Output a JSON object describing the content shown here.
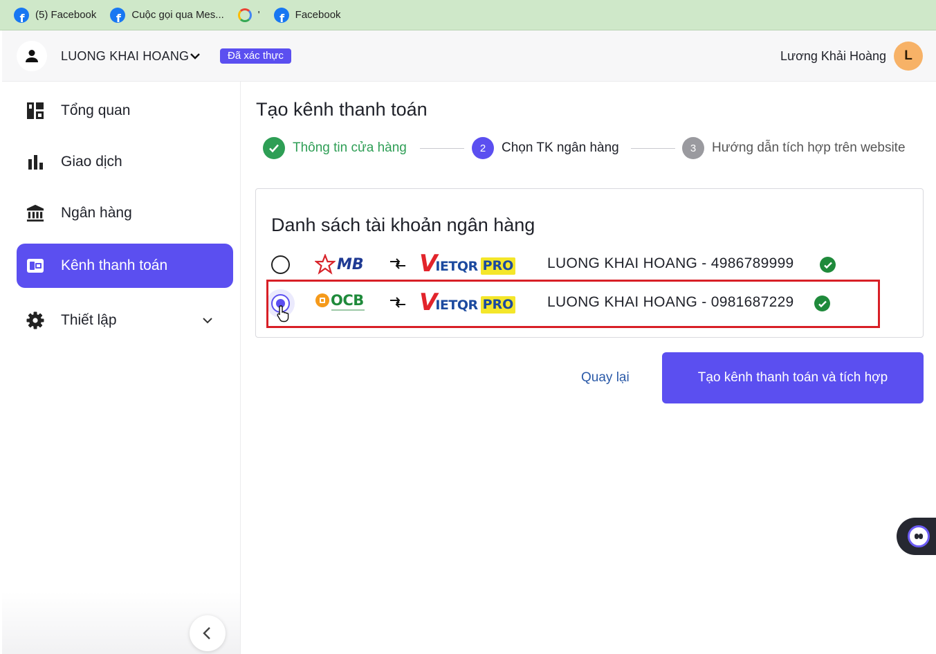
{
  "bookmarks": [
    {
      "label": "(5) Facebook",
      "icon": "facebook-icon"
    },
    {
      "label": "Cuộc gọi qua Mes...",
      "icon": "facebook-icon"
    },
    {
      "label": "'",
      "icon": "google-icon"
    },
    {
      "label": "Facebook",
      "icon": "facebook-icon"
    }
  ],
  "header": {
    "account_name": "LUONG KHAI HOANG",
    "verified_badge": "Đã xác thực",
    "user_name": "Lương Khải Hoàng",
    "avatar_initial": "L"
  },
  "sidebar": {
    "items": [
      {
        "label": "Tổng quan",
        "icon": "dashboard-icon"
      },
      {
        "label": "Giao dịch",
        "icon": "bar-chart-icon"
      },
      {
        "label": "Ngân hàng",
        "icon": "bank-icon"
      },
      {
        "label": "Kênh thanh toán",
        "icon": "wallet-icon",
        "active": true
      },
      {
        "label": "Thiết lập",
        "icon": "gear-icon"
      }
    ]
  },
  "main": {
    "title": "Tạo kênh thanh toán",
    "steps": [
      {
        "number": "1",
        "label": "Thông tin cửa hàng",
        "status": "done"
      },
      {
        "number": "2",
        "label": "Chọn TK ngân hàng",
        "status": "active"
      },
      {
        "number": "3",
        "label": "Hướng dẫn tích hợp trên website",
        "status": "pending"
      }
    ],
    "card_title": "Danh sách tài khoản ngân hàng",
    "accounts": [
      {
        "bank": "MB",
        "gateway_v": "V",
        "gateway_text": "IETQR",
        "gateway_pro": "PRO",
        "label": "LUONG KHAI HOANG - 4986789999",
        "selected": false
      },
      {
        "bank": "OCB",
        "gateway_v": "V",
        "gateway_text": "IETQR",
        "gateway_pro": "PRO",
        "label": "LUONG KHAI HOANG - 0981687229",
        "selected": true
      }
    ],
    "back_label": "Quay lại",
    "submit_label": "Tạo kênh thanh toán và tích hợp"
  },
  "colors": {
    "accent": "#5b4ff0",
    "success": "#1f8a3b",
    "step_done_text": "#2e9e55",
    "highlight": "#d81f26"
  }
}
